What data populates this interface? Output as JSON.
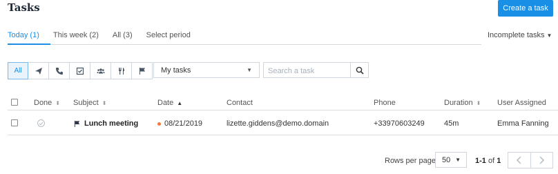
{
  "header": {
    "title": "Tasks",
    "create_label": "Create a task"
  },
  "tabs": [
    {
      "label": "Today (1)",
      "active": true
    },
    {
      "label": "This week (2)",
      "active": false
    },
    {
      "label": "All (3)",
      "active": false
    },
    {
      "label": "Select period",
      "active": false
    }
  ],
  "status_filter": {
    "label": "Incomplete tasks"
  },
  "type_filters": {
    "all_label": "All",
    "icons": [
      "paper-plane-icon",
      "phone-icon",
      "checkbox-icon",
      "people-icon",
      "fork-knife-icon",
      "flag-icon"
    ]
  },
  "owner_select": {
    "value": "My tasks"
  },
  "search": {
    "placeholder": "Search a task",
    "value": ""
  },
  "table": {
    "columns": [
      "Done",
      "Subject",
      "Date",
      "Contact",
      "Phone",
      "Duration",
      "User Assigned"
    ],
    "rows": [
      {
        "subject": "Lunch meeting",
        "subject_icon": "flag-icon",
        "date": "08/21/2019",
        "contact": "lizette.giddens@demo.domain",
        "phone": "+33970603249",
        "duration": "45m",
        "user": "Emma Fanning"
      }
    ]
  },
  "pagination": {
    "rows_per_page_label": "Rows per page",
    "rows_per_page": "50",
    "range": "1-1",
    "of_label": "of",
    "total": "1"
  },
  "colors": {
    "accent": "#1a8fe6",
    "date_dot": "#f07b3f"
  }
}
